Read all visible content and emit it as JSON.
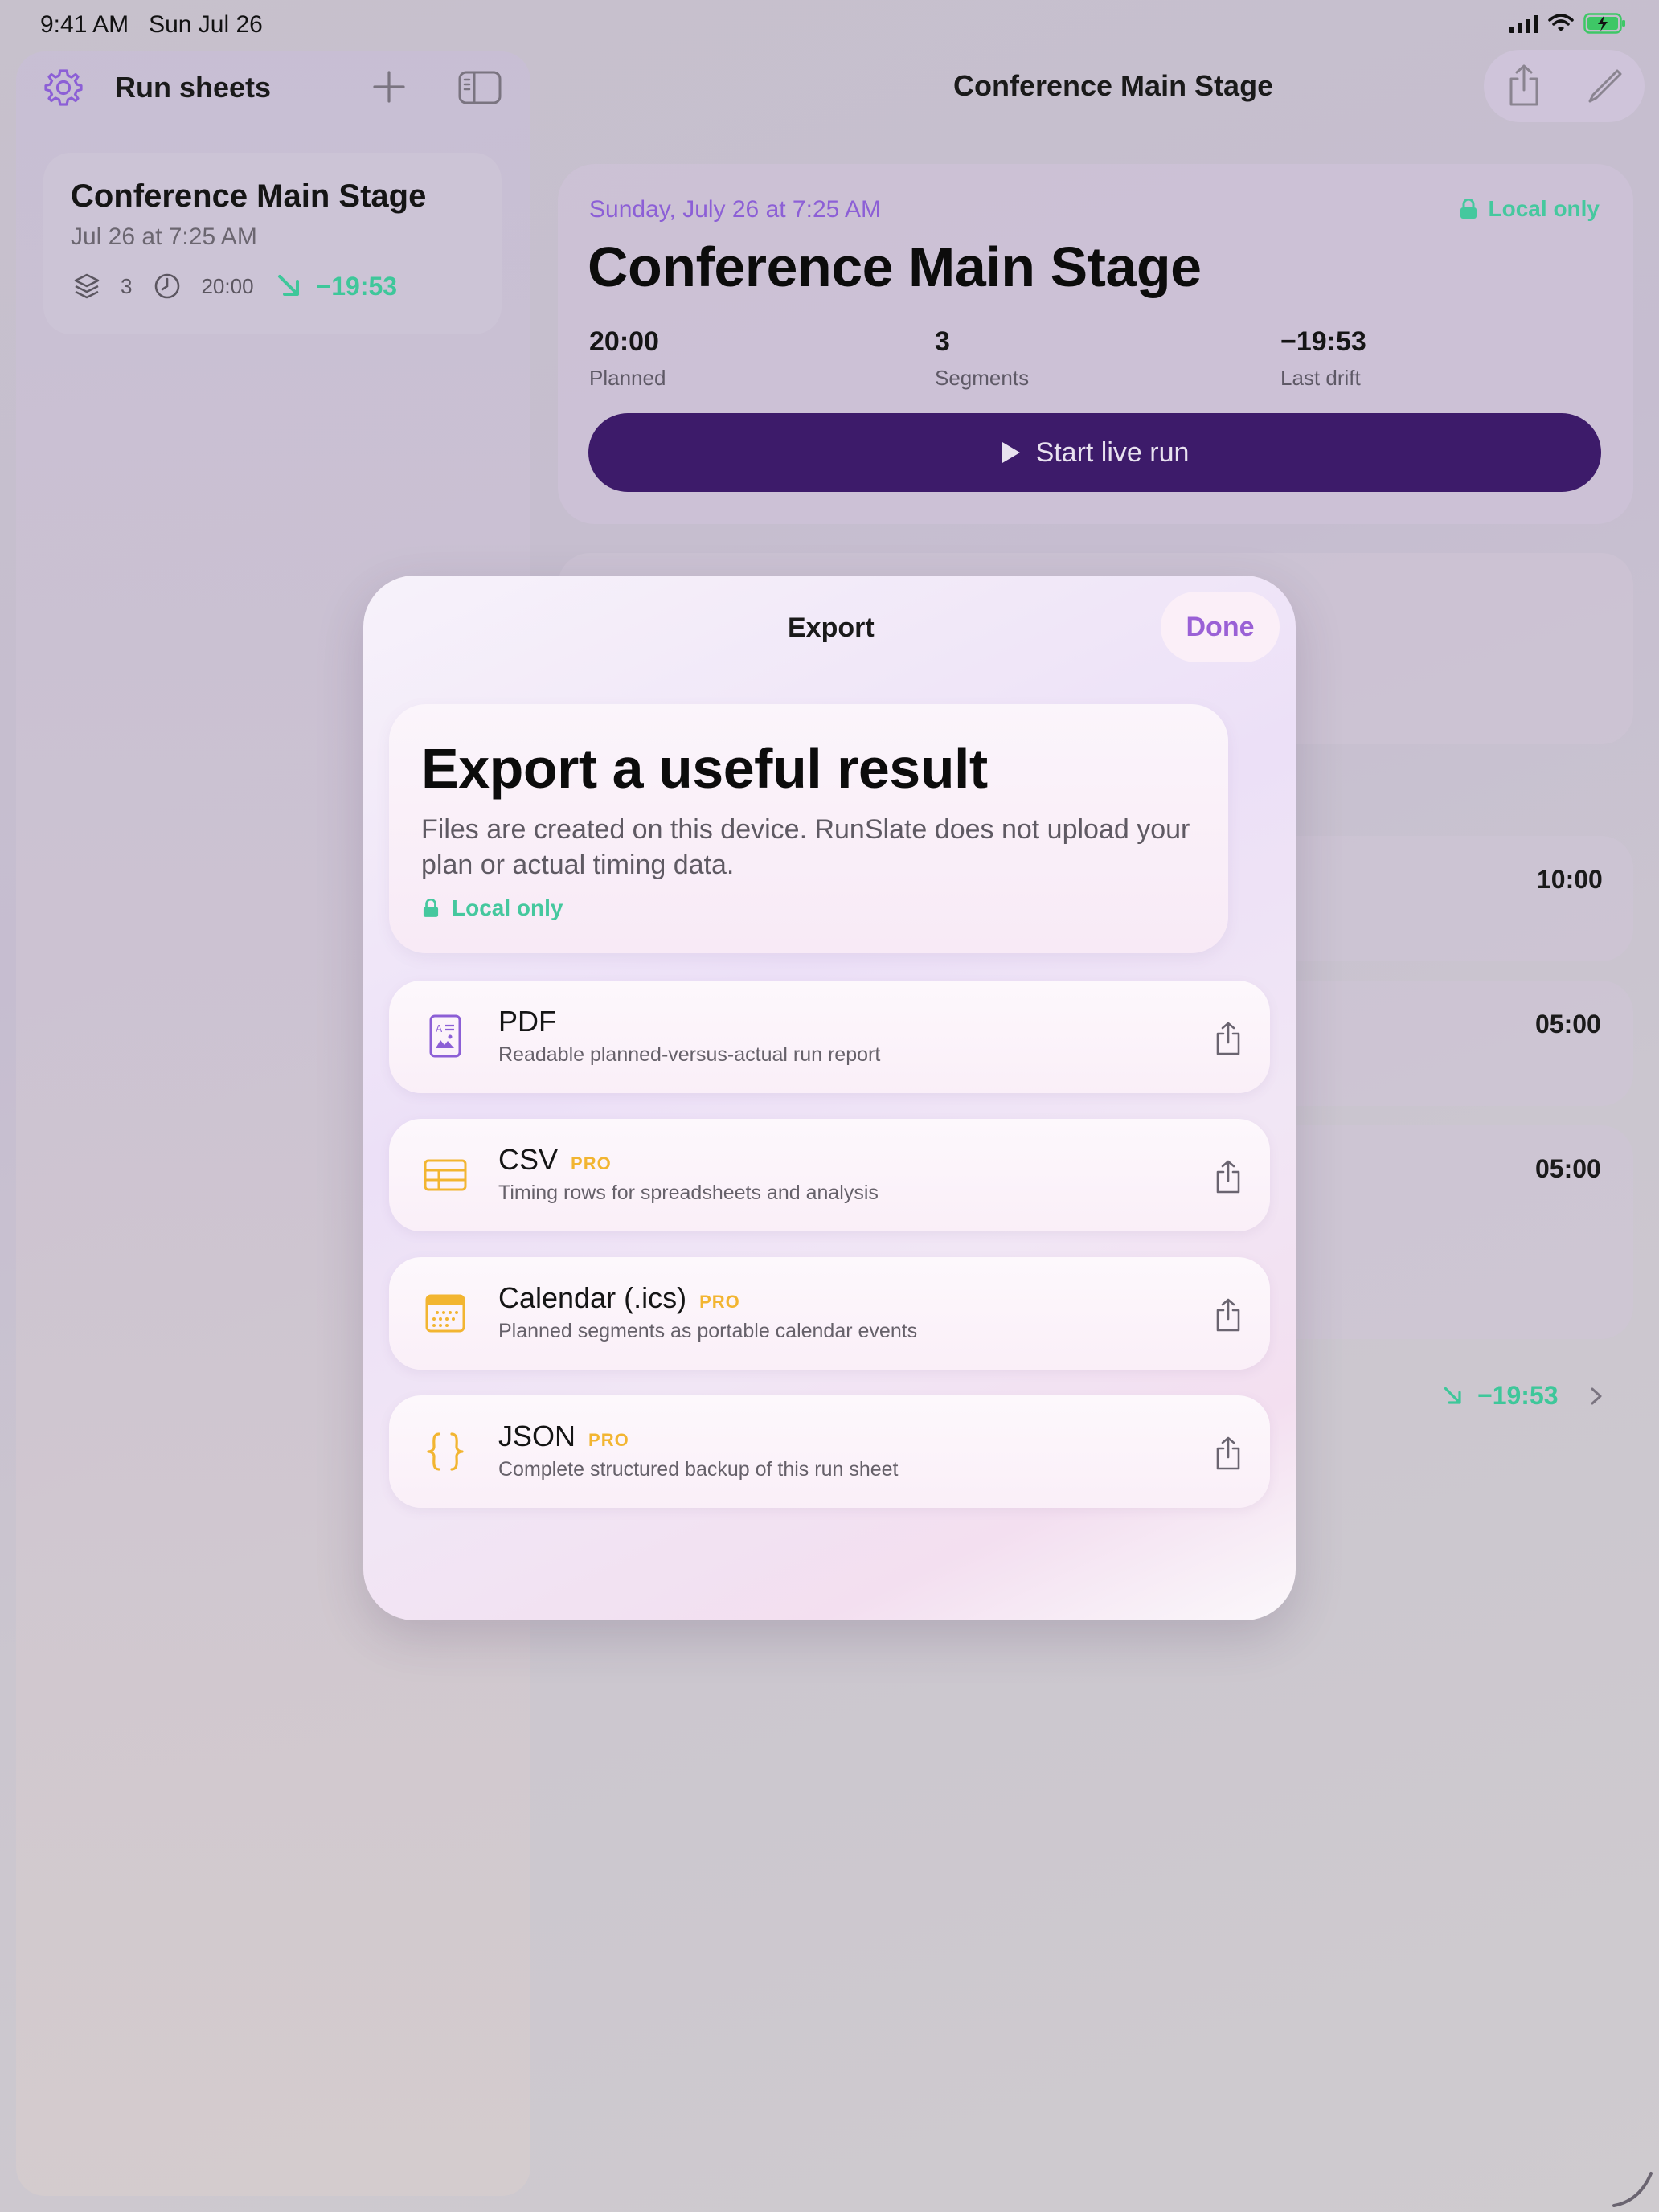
{
  "status_bar": {
    "time": "9:41 AM   Sun Jul 26"
  },
  "sidebar": {
    "title": "Run sheets",
    "sheets": [
      {
        "title": "Conference Main Stage",
        "date": "Jul 26 at 7:25 AM",
        "segments": "3",
        "duration": "20:00",
        "drift": "−19:53"
      }
    ]
  },
  "main": {
    "title": "Conference Main Stage",
    "detail": {
      "date": "Sunday, July 26 at 7:25 AM",
      "local_badge": "Local only",
      "title": "Conference Main Stage",
      "stats": [
        {
          "value": "20:00",
          "label": "Planned"
        },
        {
          "value": "3",
          "label": "Segments"
        },
        {
          "value": "−19:53",
          "label": "Last drift"
        }
      ],
      "start_label": "Start live run"
    },
    "background_rows": {
      "times": [
        "10:00",
        "05:00",
        "05:00"
      ],
      "drift": "−19:53"
    }
  },
  "modal": {
    "title": "Export",
    "done_label": "Done",
    "hero": {
      "title": "Export a useful result",
      "body": "Files are created on this device. RunSlate does not upload your plan or actual timing data.",
      "local_badge": "Local only"
    },
    "options": [
      {
        "name": "PDF",
        "pro": "",
        "description": "Readable planned-versus-actual run report",
        "icon": "pdf-document-icon",
        "color": "#8c5fd6"
      },
      {
        "name": "CSV",
        "pro": "PRO",
        "description": "Timing rows for spreadsheets and analysis",
        "icon": "table-grid-icon",
        "color": "#f2b531"
      },
      {
        "name": "Calendar (.ics)",
        "pro": "PRO",
        "description": "Planned segments as portable calendar events",
        "icon": "calendar-icon",
        "color": "#f2b531"
      },
      {
        "name": "JSON",
        "pro": "PRO",
        "description": "Complete structured backup of this run sheet",
        "icon": "curly-braces-icon",
        "color": "#f2b531"
      }
    ]
  },
  "colors": {
    "accent_purple": "#8c5fd6",
    "accent_green": "#45c89e",
    "pro_gold": "#f2b531",
    "start_button": "#3d1b6a"
  }
}
